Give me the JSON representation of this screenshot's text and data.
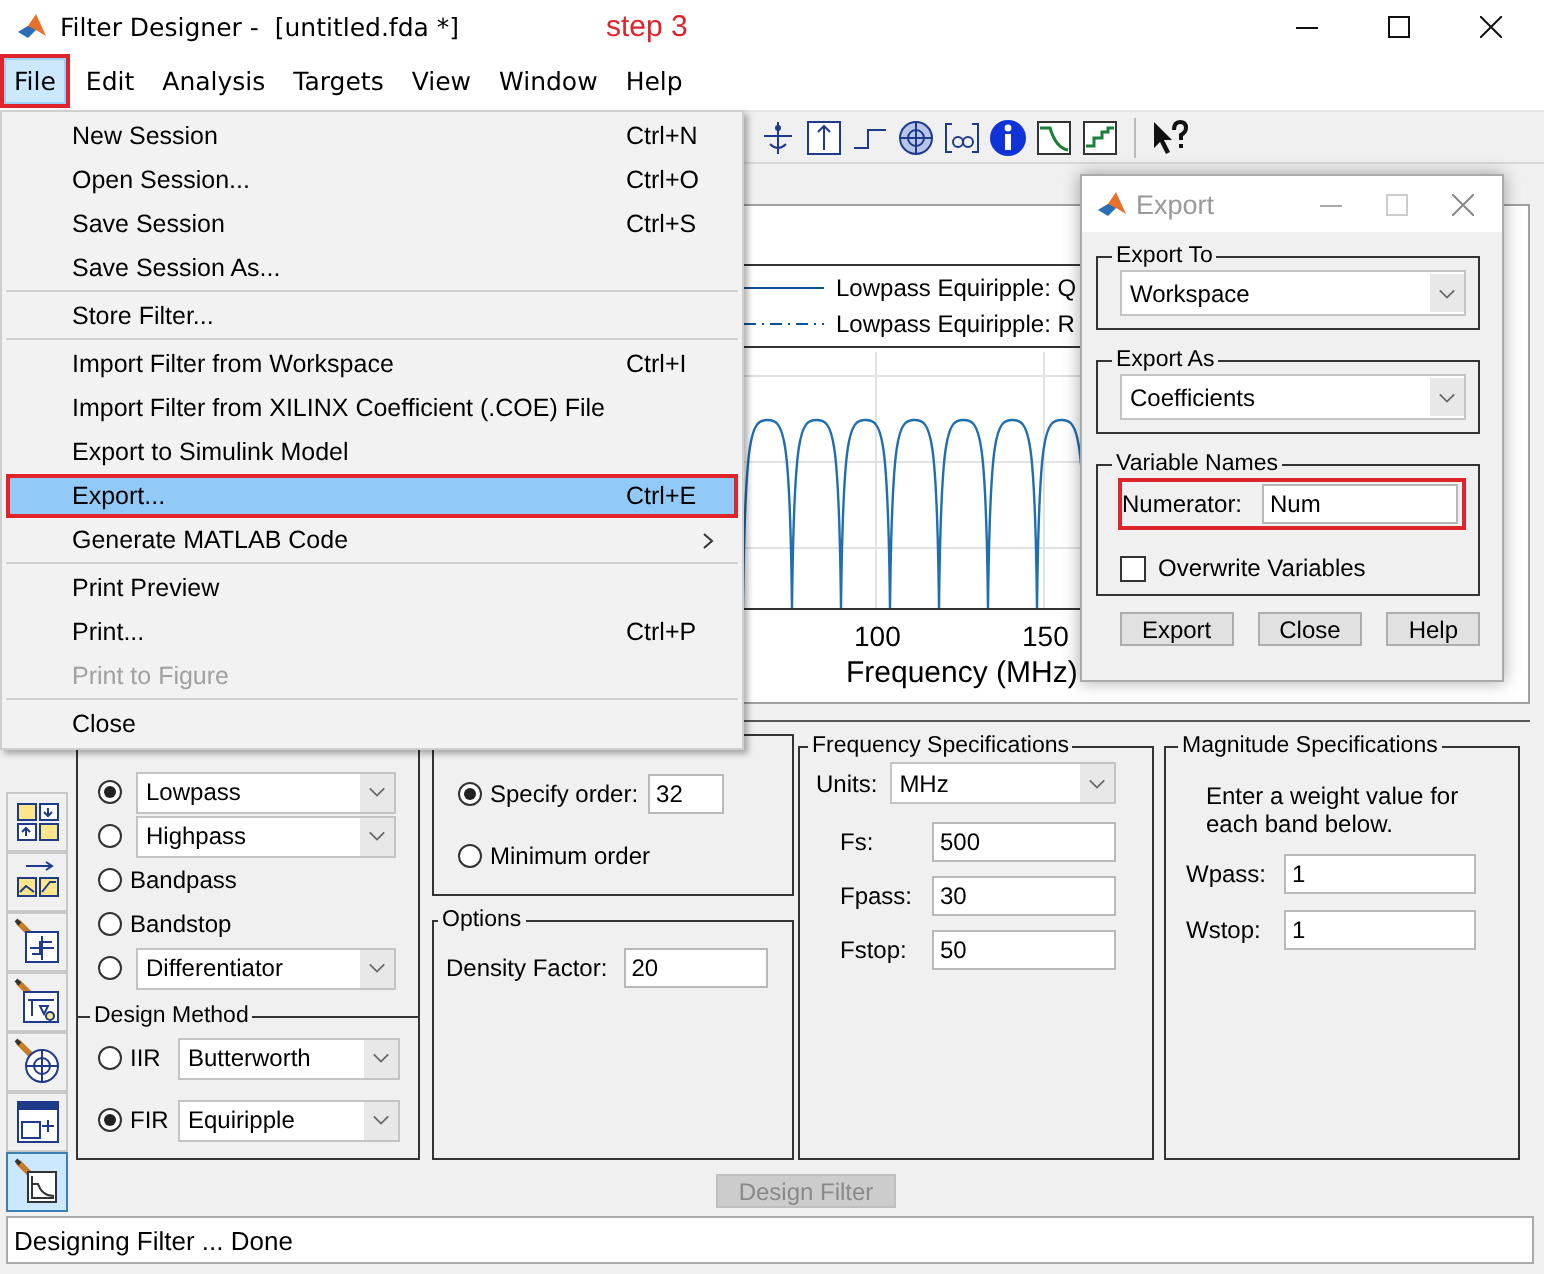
{
  "window": {
    "title": "Filter Designer -  [untitled.fda *]",
    "annotation": "step 3"
  },
  "menubar": [
    {
      "label": "File",
      "selected": true,
      "annotated": true
    },
    {
      "label": "Edit",
      "selected": false,
      "annotated": false
    },
    {
      "label": "Analysis",
      "selected": false,
      "annotated": false
    },
    {
      "label": "Targets",
      "selected": false,
      "annotated": false
    },
    {
      "label": "View",
      "selected": false,
      "annotated": false
    },
    {
      "label": "Window",
      "selected": false,
      "annotated": false
    },
    {
      "label": "Help",
      "selected": false,
      "annotated": false
    }
  ],
  "file_menu": {
    "groups": [
      [
        {
          "label": "New Session",
          "shortcut": "Ctrl+N",
          "selected": false,
          "disabled": false,
          "submenu": false,
          "annotated": false
        },
        {
          "label": "Open Session...",
          "shortcut": "Ctrl+O",
          "selected": false,
          "disabled": false,
          "submenu": false,
          "annotated": false
        },
        {
          "label": "Save Session",
          "shortcut": "Ctrl+S",
          "selected": false,
          "disabled": false,
          "submenu": false,
          "annotated": false
        },
        {
          "label": "Save Session As...",
          "selected": false,
          "disabled": false,
          "submenu": false,
          "annotated": false
        }
      ],
      [
        {
          "label": "Store Filter...",
          "selected": false,
          "disabled": false,
          "submenu": false,
          "annotated": false
        }
      ],
      [
        {
          "label": "Import Filter from Workspace",
          "shortcut": "Ctrl+I",
          "selected": false,
          "disabled": false,
          "submenu": false,
          "annotated": false
        },
        {
          "label": "Import Filter from XILINX Coefficient (.COE) File",
          "selected": false,
          "disabled": false,
          "submenu": false,
          "annotated": false
        },
        {
          "label": "Export to Simulink Model",
          "selected": false,
          "disabled": false,
          "submenu": false,
          "annotated": false
        },
        {
          "label": "Export...",
          "shortcut": "Ctrl+E",
          "selected": true,
          "disabled": false,
          "submenu": false,
          "annotated": true
        },
        {
          "label": "Generate MATLAB Code",
          "selected": false,
          "disabled": false,
          "submenu": true,
          "annotated": false
        }
      ],
      [
        {
          "label": "Print Preview",
          "selected": false,
          "disabled": false,
          "submenu": false,
          "annotated": false
        },
        {
          "label": "Print...",
          "shortcut": "Ctrl+P",
          "selected": false,
          "disabled": false,
          "submenu": false,
          "annotated": false
        },
        {
          "label": "Print to Figure",
          "selected": false,
          "disabled": true,
          "submenu": false,
          "annotated": false
        }
      ],
      [
        {
          "label": "Close",
          "selected": false,
          "disabled": false,
          "submenu": false,
          "annotated": false
        }
      ]
    ]
  },
  "plot": {
    "legend": [
      {
        "label": "Lowpass Equiripple: Q",
        "kind": "solid"
      },
      {
        "label": "Lowpass Equiripple: R",
        "kind": "dashdot"
      }
    ],
    "ticks": [
      "100",
      "150"
    ],
    "xlabel": "Frequency (MHz)"
  },
  "sidebar": [
    {
      "kind": "blocks",
      "selected": false
    },
    {
      "kind": "arrow-blocks",
      "selected": false
    },
    {
      "kind": "pencil-plot",
      "selected": false
    },
    {
      "kind": "pencil-diagram",
      "selected": false
    },
    {
      "kind": "pencil-circle",
      "selected": false
    },
    {
      "kind": "window-diagram",
      "selected": false
    },
    {
      "kind": "pencil-chart",
      "selected": true
    }
  ],
  "response_type": {
    "options": [
      {
        "kind": "dropdown",
        "value": "Lowpass",
        "selected": true
      },
      {
        "kind": "dropdown",
        "value": "Highpass",
        "selected": false
      },
      {
        "kind": "text",
        "label": "Bandpass",
        "selected": false
      },
      {
        "kind": "text",
        "label": "Bandstop",
        "selected": false
      },
      {
        "kind": "dropdown",
        "value": "Differentiator",
        "selected": false
      }
    ],
    "design_method": {
      "title": "Design Method",
      "options": [
        {
          "kind": "dropdown",
          "label": "IIR",
          "value": "Butterworth",
          "selected": false
        },
        {
          "kind": "dropdown",
          "label": "FIR",
          "value": "Equiripple",
          "selected": true
        }
      ]
    }
  },
  "filter_order": {
    "options": [
      {
        "kind": "field",
        "label": "Specify order:",
        "value": "32",
        "selected": true
      },
      {
        "kind": "text",
        "label": "Minimum order",
        "selected": false
      }
    ]
  },
  "options": {
    "title": "Options",
    "fields": [
      {
        "label": "Density Factor:",
        "value": "20"
      }
    ]
  },
  "frequency_specifications": {
    "title": "Frequency Specifications",
    "units": {
      "label": "Units:",
      "value": "MHz"
    },
    "fields": [
      {
        "label": "Fs:",
        "value": "500"
      },
      {
        "label": "Fpass:",
        "value": "30"
      },
      {
        "label": "Fstop:",
        "value": "50"
      }
    ]
  },
  "magnitude_specifications": {
    "title": "Magnitude Specifications",
    "note": "Enter a weight value for each band below.",
    "fields": [
      {
        "label": "Wpass:",
        "value": "1"
      },
      {
        "label": "Wstop:",
        "value": "1"
      }
    ]
  },
  "design_button": {
    "label": "Design Filter",
    "disabled": true
  },
  "status_bar": "Designing Filter ... Done",
  "export_dialog": {
    "title": "Export",
    "export_to": {
      "title": "Export To",
      "value": "Workspace"
    },
    "export_as": {
      "title": "Export As",
      "value": "Coefficients"
    },
    "variable_names": {
      "title": "Variable Names",
      "fields": [
        {
          "label": "Numerator:",
          "value": "Num",
          "annotated": true
        }
      ]
    },
    "overwrite": {
      "label": "Overwrite Variables",
      "checked": false
    },
    "buttons": [
      {
        "label": "Export"
      },
      {
        "label": "Close"
      },
      {
        "label": "Help"
      }
    ]
  }
}
